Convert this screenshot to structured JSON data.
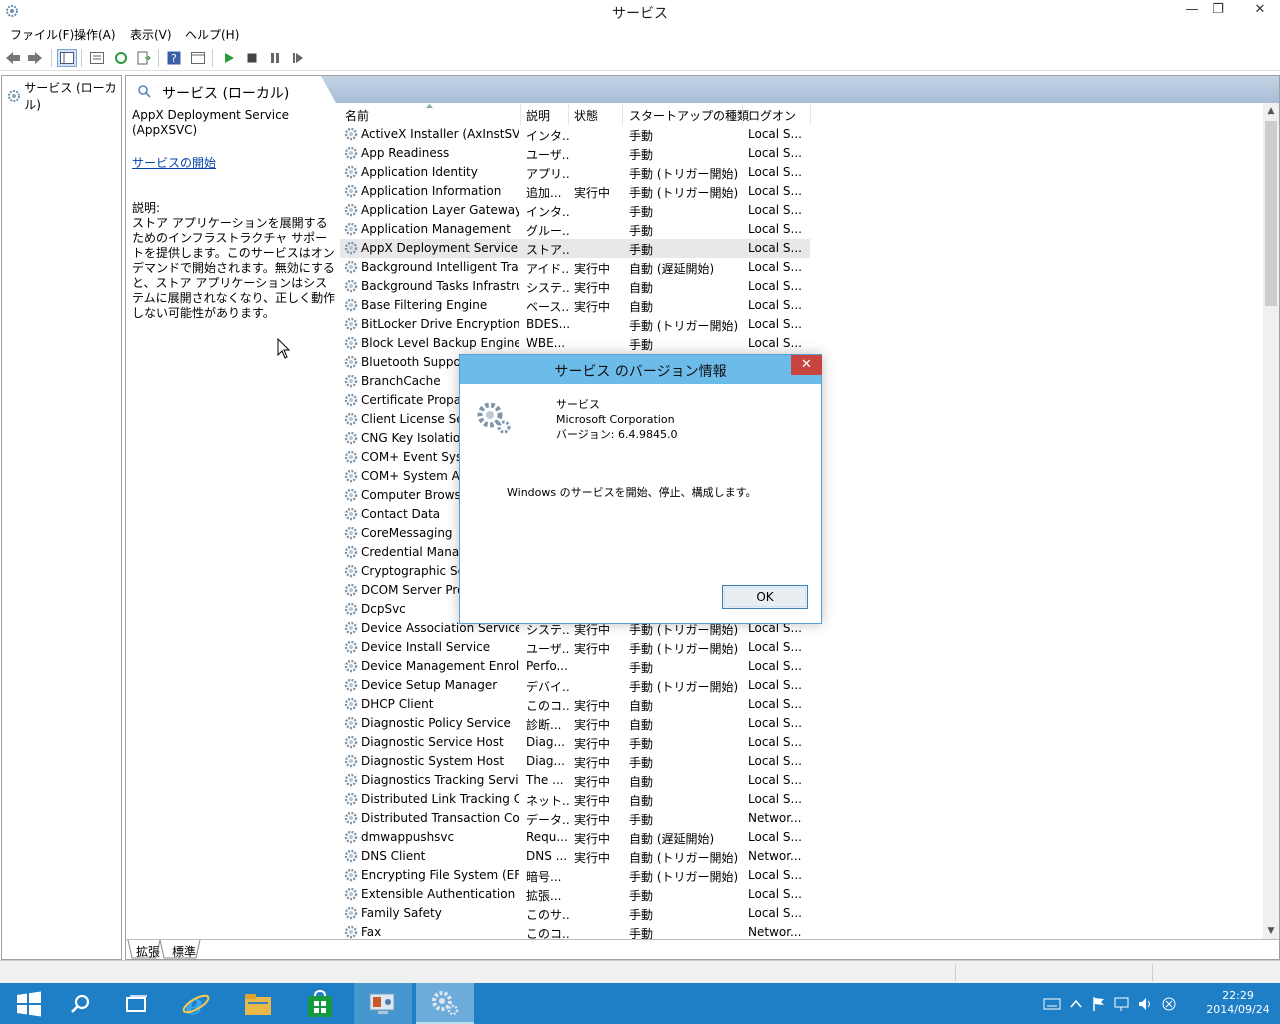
{
  "window": {
    "title": "サービス",
    "minimize": "—",
    "restore": "❐",
    "close": "✕"
  },
  "menu": {
    "file": "ファイル(F)",
    "action": "操作(A)",
    "view": "表示(V)",
    "help": "ヘルプ(H)"
  },
  "tree": {
    "root": "サービス (ローカル)"
  },
  "pane": {
    "header": "サービス (ローカル)",
    "selected_service": "AppX Deployment Service (AppXSVC)",
    "start_link": "サービスの開始",
    "desc_label": "説明:",
    "description": "ストア アプリケーションを展開するためのインフラストラクチャ サポートを提供します。このサービスはオンデマンドで開始されます。無効にすると、ストア アプリケーションはシステムに展開されなくなり、正しく動作しない可能性があります。"
  },
  "columns": {
    "name": "名前",
    "description": "説明",
    "status": "状態",
    "startup": "スタートアップの種類",
    "logon": "ログオン"
  },
  "services": [
    {
      "name": "ActiveX Installer (AxInstSV)",
      "desc": "インタ...",
      "status": "",
      "startup": "手動",
      "logon": "Local S..."
    },
    {
      "name": "App Readiness",
      "desc": "ユーザ...",
      "status": "",
      "startup": "手動",
      "logon": "Local S..."
    },
    {
      "name": "Application Identity",
      "desc": "アプリ...",
      "status": "",
      "startup": "手動 (トリガー開始)",
      "logon": "Local S..."
    },
    {
      "name": "Application Information",
      "desc": "追加...",
      "status": "実行中",
      "startup": "手動 (トリガー開始)",
      "logon": "Local S..."
    },
    {
      "name": "Application Layer Gateway ...",
      "desc": "インタ...",
      "status": "",
      "startup": "手動",
      "logon": "Local S..."
    },
    {
      "name": "Application Management",
      "desc": "グルー...",
      "status": "",
      "startup": "手動",
      "logon": "Local S..."
    },
    {
      "name": "AppX Deployment Service (...",
      "desc": "ストア...",
      "status": "",
      "startup": "手動",
      "logon": "Local S..."
    },
    {
      "name": "Background Intelligent Tran...",
      "desc": "アイド...",
      "status": "実行中",
      "startup": "自動 (遅延開始)",
      "logon": "Local S..."
    },
    {
      "name": "Background Tasks Infrastru...",
      "desc": "システ...",
      "status": "実行中",
      "startup": "自動",
      "logon": "Local S..."
    },
    {
      "name": "Base Filtering Engine",
      "desc": "ベース...",
      "status": "実行中",
      "startup": "自動",
      "logon": "Local S..."
    },
    {
      "name": "BitLocker Drive Encryption ...",
      "desc": "BDES...",
      "status": "",
      "startup": "手動 (トリガー開始)",
      "logon": "Local S..."
    },
    {
      "name": "Block Level Backup Engine ...",
      "desc": "WBE...",
      "status": "",
      "startup": "手動",
      "logon": "Local S..."
    },
    {
      "name": "Bluetooth Support",
      "desc": "",
      "status": "",
      "startup": "",
      "logon": ""
    },
    {
      "name": "BranchCache",
      "desc": "",
      "status": "",
      "startup": "",
      "logon": ""
    },
    {
      "name": "Certificate Propaga",
      "desc": "",
      "status": "",
      "startup": "",
      "logon": ""
    },
    {
      "name": "Client License Serv",
      "desc": "",
      "status": "",
      "startup": "",
      "logon": ""
    },
    {
      "name": "CNG Key Isolation",
      "desc": "",
      "status": "",
      "startup": "",
      "logon": ""
    },
    {
      "name": "COM+ Event Syste",
      "desc": "",
      "status": "",
      "startup": "",
      "logon": ""
    },
    {
      "name": "COM+ System App",
      "desc": "",
      "status": "",
      "startup": "",
      "logon": ""
    },
    {
      "name": "Computer Browser",
      "desc": "",
      "status": "",
      "startup": "",
      "logon": ""
    },
    {
      "name": "Contact Data",
      "desc": "",
      "status": "",
      "startup": "",
      "logon": ""
    },
    {
      "name": "CoreMessaging",
      "desc": "",
      "status": "",
      "startup": "",
      "logon": ""
    },
    {
      "name": "Credential Manage",
      "desc": "",
      "status": "",
      "startup": "",
      "logon": ""
    },
    {
      "name": "Cryptographic Serv",
      "desc": "",
      "status": "",
      "startup": "",
      "logon": ""
    },
    {
      "name": "DCOM Server Proc",
      "desc": "",
      "status": "",
      "startup": "",
      "logon": ""
    },
    {
      "name": "DcpSvc",
      "desc": "",
      "status": "",
      "startup": "",
      "logon": ""
    },
    {
      "name": "Device Association Service",
      "desc": "システ...",
      "status": "実行中",
      "startup": "手動 (トリガー開始)",
      "logon": "Local S..."
    },
    {
      "name": "Device Install Service",
      "desc": "ユーザ...",
      "status": "実行中",
      "startup": "手動 (トリガー開始)",
      "logon": "Local S..."
    },
    {
      "name": "Device Management Enroll...",
      "desc": "Perfo...",
      "status": "",
      "startup": "手動",
      "logon": "Local S..."
    },
    {
      "name": "Device Setup Manager",
      "desc": "デバイ...",
      "status": "",
      "startup": "手動 (トリガー開始)",
      "logon": "Local S..."
    },
    {
      "name": "DHCP Client",
      "desc": "このコ...",
      "status": "実行中",
      "startup": "自動",
      "logon": "Local S..."
    },
    {
      "name": "Diagnostic Policy Service",
      "desc": "診断...",
      "status": "実行中",
      "startup": "自動",
      "logon": "Local S..."
    },
    {
      "name": "Diagnostic Service Host",
      "desc": "Diag...",
      "status": "実行中",
      "startup": "手動",
      "logon": "Local S..."
    },
    {
      "name": "Diagnostic System Host",
      "desc": "Diag...",
      "status": "実行中",
      "startup": "手動",
      "logon": "Local S..."
    },
    {
      "name": "Diagnostics Tracking Service",
      "desc": "The ...",
      "status": "実行中",
      "startup": "自動",
      "logon": "Local S..."
    },
    {
      "name": "Distributed Link Tracking Cl...",
      "desc": "ネット...",
      "status": "実行中",
      "startup": "自動",
      "logon": "Local S..."
    },
    {
      "name": "Distributed Transaction Co...",
      "desc": "データ...",
      "status": "実行中",
      "startup": "手動",
      "logon": "Networ..."
    },
    {
      "name": "dmwappushsvc",
      "desc": "Requ...",
      "status": "実行中",
      "startup": "自動 (遅延開始)",
      "logon": "Local S..."
    },
    {
      "name": "DNS Client",
      "desc": "DNS ...",
      "status": "実行中",
      "startup": "自動 (トリガー開始)",
      "logon": "Networ..."
    },
    {
      "name": "Encrypting File System (EFS)",
      "desc": "暗号...",
      "status": "",
      "startup": "手動 (トリガー開始)",
      "logon": "Local S..."
    },
    {
      "name": "Extensible Authentication P...",
      "desc": "拡張...",
      "status": "",
      "startup": "手動",
      "logon": "Local S..."
    },
    {
      "name": "Family Safety",
      "desc": "このサ...",
      "status": "",
      "startup": "手動",
      "logon": "Local S..."
    },
    {
      "name": "Fax",
      "desc": "このコ...",
      "status": "",
      "startup": "手動",
      "logon": "Networ..."
    }
  ],
  "bottom_tabs": {
    "extended": "拡張",
    "standard": "標準"
  },
  "dialog": {
    "title": "サービス のバージョン情報",
    "close": "✕",
    "product": "サービス",
    "company": "Microsoft Corporation",
    "version": "バージョン: 6.4.9845.0",
    "message": "Windows のサービスを開始、停止、構成します。",
    "ok": "OK"
  },
  "taskbar": {
    "time": "22:29",
    "date": "2014/09/24"
  },
  "colors": {
    "taskbar": "#1e7fc6",
    "dialog_title": "#6cbbe8",
    "close_red": "#c7453e",
    "link": "#0645ad"
  }
}
